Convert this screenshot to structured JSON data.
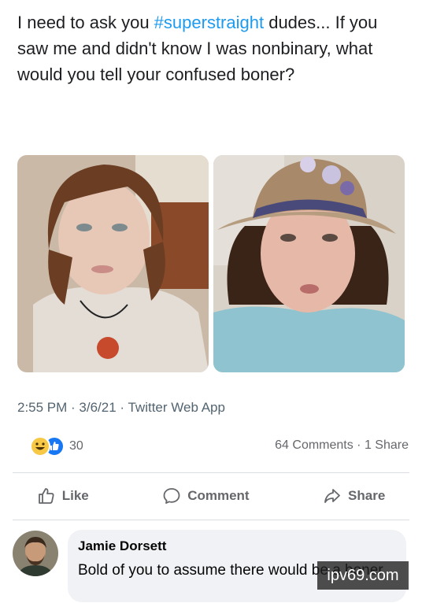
{
  "post": {
    "text_part1": "I need to ask you ",
    "hashtag": "#superstraight",
    "text_part2": " dudes... If you saw me and didn't know I was nonbinary, what would you tell your confused boner?",
    "meta": "2:55 PM · 3/6/21 · Twitter Web App"
  },
  "reactions": {
    "count": "30"
  },
  "stats": {
    "comments": "64 Comments",
    "separator": " · ",
    "shares": "1 Share"
  },
  "actions": {
    "like": "Like",
    "comment": "Comment",
    "share": "Share"
  },
  "comment": {
    "author": "Jamie Dorsett",
    "text": "Bold of you to assume there would be a boner"
  },
  "watermark": "ipv69.com",
  "colors": {
    "hashtag": "#1d9bf0",
    "like_blue": "#1877f2",
    "haha_yellow": "#f7c845"
  }
}
